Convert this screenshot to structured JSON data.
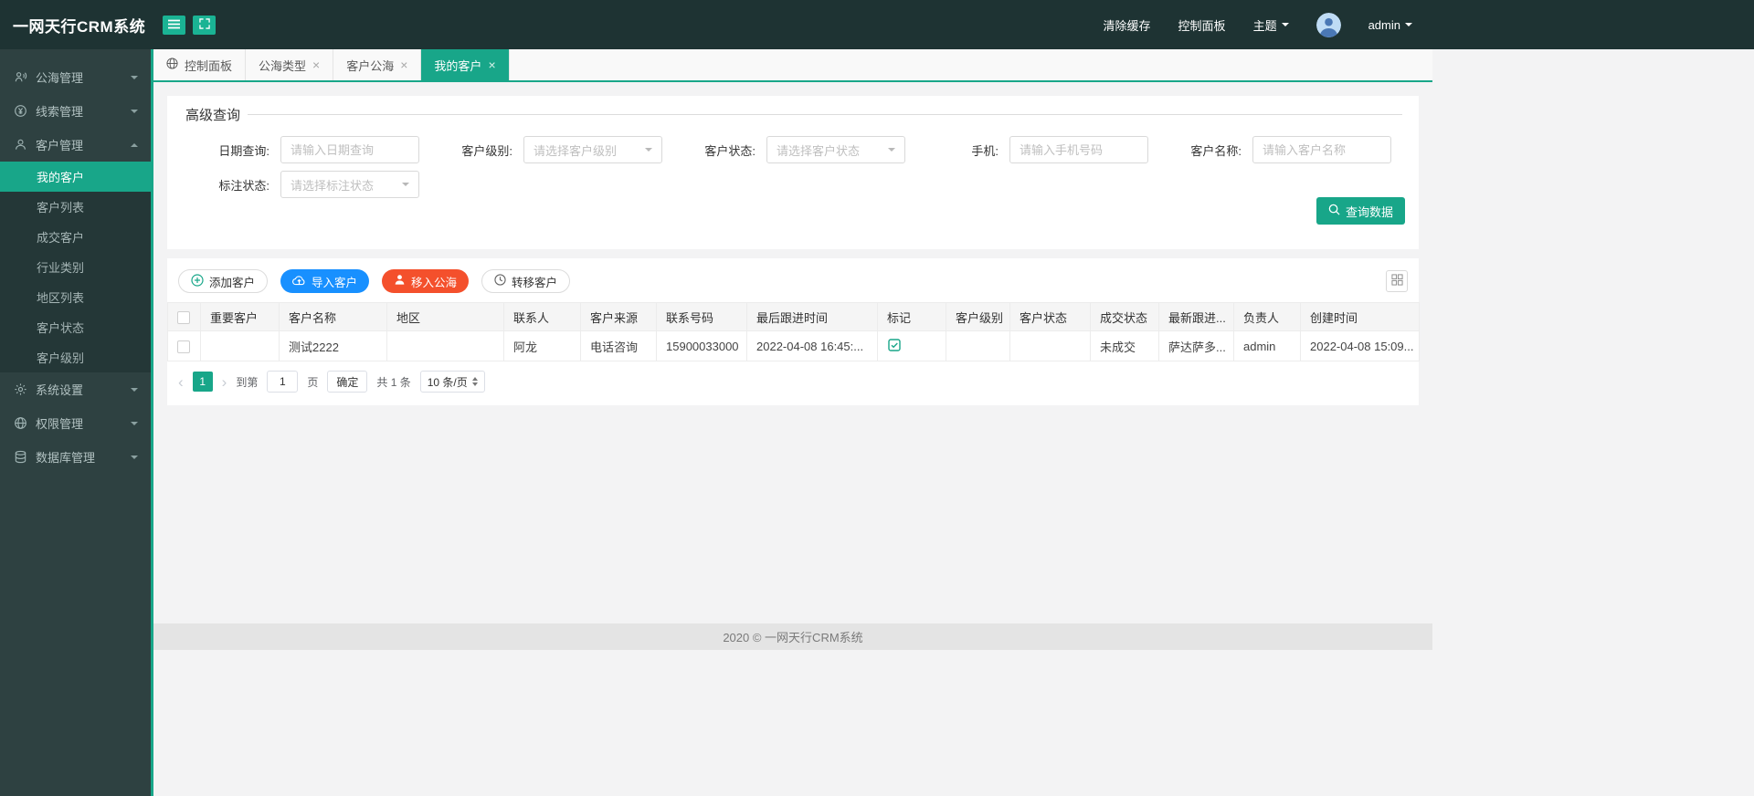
{
  "app": {
    "brand": "一网天行CRM系统"
  },
  "header": {
    "clear_cache": "清除缓存",
    "control_panel": "控制面板",
    "theme": "主题",
    "username": "admin"
  },
  "sidebar": {
    "items": [
      {
        "label": "公海管理"
      },
      {
        "label": "线索管理"
      },
      {
        "label": "客户管理",
        "children": [
          "我的客户",
          "客户列表",
          "成交客户",
          "行业类别",
          "地区列表",
          "客户状态",
          "客户级别"
        ]
      },
      {
        "label": "系统设置"
      },
      {
        "label": "权限管理"
      },
      {
        "label": "数据库管理"
      }
    ]
  },
  "tabs": [
    {
      "label": "控制面板"
    },
    {
      "label": "公海类型"
    },
    {
      "label": "客户公海"
    },
    {
      "label": "我的客户"
    }
  ],
  "query": {
    "legend": "高级查询",
    "fields": {
      "date": {
        "label": "日期查询:",
        "placeholder": "请输入日期查询"
      },
      "level": {
        "label": "客户级别:",
        "placeholder": "请选择客户级别"
      },
      "status": {
        "label": "客户状态:",
        "placeholder": "请选择客户状态"
      },
      "phone": {
        "label": "手机:",
        "placeholder": "请输入手机号码"
      },
      "name": {
        "label": "客户名称:",
        "placeholder": "请输入客户名称"
      },
      "mark": {
        "label": "标注状态:",
        "placeholder": "请选择标注状态"
      }
    },
    "search_button": "查询数据"
  },
  "toolbar": {
    "add": "添加客户",
    "import": "导入客户",
    "move_to_sea": "移入公海",
    "transfer": "转移客户"
  },
  "table": {
    "columns": [
      "重要客户",
      "客户名称",
      "地区",
      "联系人",
      "客户来源",
      "联系号码",
      "最后跟进时间",
      "标记",
      "客户级别",
      "客户状态",
      "成交状态",
      "最新跟进...",
      "负责人",
      "创建时间"
    ],
    "rows": [
      {
        "cells": [
          "",
          "测试2222",
          "",
          "阿龙",
          "电话咨询",
          "15900033000",
          "2022-04-08 16:45:...",
          "",
          "",
          "",
          "未成交",
          "萨达萨多...",
          "admin",
          "2022-04-08 15:09..."
        ]
      }
    ]
  },
  "pagination": {
    "prev": "‹",
    "next": "›",
    "current": "1",
    "goto_prefix": "到第",
    "goto_value": "1",
    "goto_suffix": "页",
    "confirm": "确定",
    "total": "共 1 条",
    "page_size": "10 条/页"
  },
  "footer": {
    "copyright": "2020 ©  一网天行CRM系统"
  },
  "icons": {
    "close": "×"
  },
  "colors": {
    "accent": "#18a689",
    "blue": "#1890ff",
    "red": "#f4502c",
    "dark": "#1e3333"
  }
}
